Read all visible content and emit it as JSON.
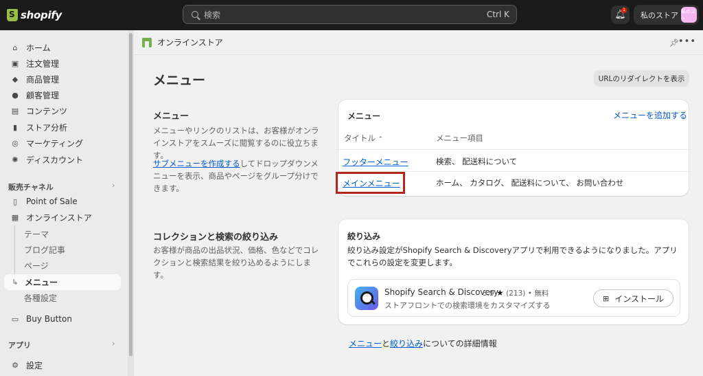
{
  "topbar": {
    "brand": "shopify",
    "search_placeholder": "検索",
    "search_shortcut": "Ctrl K",
    "notification_count": "1",
    "store_label": "私のストア",
    "avatar_text": "私のスト"
  },
  "sidebar": {
    "items": [
      {
        "label": "ホーム",
        "icon": "home-icon"
      },
      {
        "label": "注文管理",
        "icon": "inbox-icon"
      },
      {
        "label": "商品管理",
        "icon": "tag-icon"
      },
      {
        "label": "顧客管理",
        "icon": "person-icon"
      },
      {
        "label": "コンテンツ",
        "icon": "content-icon"
      },
      {
        "label": "ストア分析",
        "icon": "bar-chart-icon"
      },
      {
        "label": "マーケティング",
        "icon": "target-icon"
      },
      {
        "label": "ディスカウント",
        "icon": "discount-icon"
      }
    ],
    "sales_channels_heading": "販売チャネル",
    "channels": {
      "pos": "Point of Sale",
      "online_store": "オンラインストア",
      "sub": [
        "テーマ",
        "ブログ記事",
        "ページ",
        "メニュー",
        "各種設定"
      ],
      "buy_button": "Buy Button"
    },
    "apps_heading": "アプリ",
    "settings": "設定"
  },
  "breadcrumb": {
    "label": "オンラインストア"
  },
  "page": {
    "title": "メニュー",
    "redirect_button": "URLのリダイレクトを表示"
  },
  "menu_section": {
    "title": "メニュー",
    "description": "メニューやリンクのリストは、お客様がオンラインストアをスムーズに閲覧するのに役立ちます。",
    "submenu_link": "サブメニューを作成する",
    "submenu_text": "してドロップダウンメニューを表示、商品やページをグループ分けできます。",
    "card_title": "メニュー",
    "add_link": "メニューを追加する",
    "col_title": "タイトル",
    "col_items": "メニュー項目",
    "rows": [
      {
        "title": "フッターメニュー",
        "items": "検索、 配送料について"
      },
      {
        "title": "メインメニュー",
        "items": "ホーム、 カタログ、 配送料について、 お問い合わせ"
      }
    ]
  },
  "filter_section": {
    "title": "コレクションと検索の絞り込み",
    "description": "お客様が商品の出品状況、価格、色などでコレクションと検索結果を絞り込めるようにします。",
    "card_title": "絞り込み",
    "card_text": "絞り込み設定がShopify Search & Discoveryアプリで利用できるようになりました。アプリでこれらの設定を変更します。",
    "app": {
      "name": "Shopify Search & Discovery",
      "rating": "3.9",
      "reviews": "(213) • 無料",
      "subtitle": "ストアフロントでの検索環境をカスタマイズする",
      "install": "インストール"
    }
  },
  "footer": {
    "link1": "メニュー",
    "and": "と",
    "link2": "絞り込み",
    "suffix": "についての詳細情報"
  }
}
